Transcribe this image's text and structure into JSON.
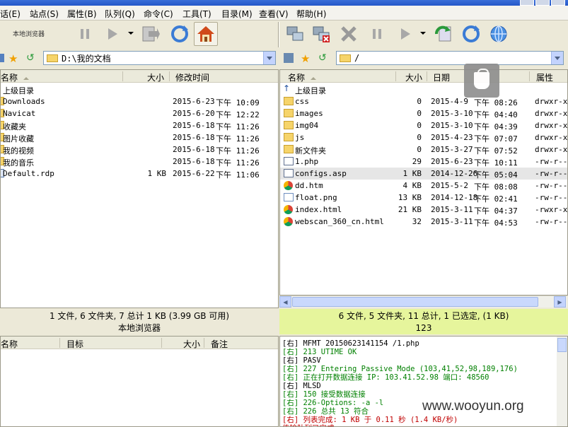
{
  "menu": [
    "话(E)",
    "站点(S)",
    "属性(B)",
    "队列(Q)",
    "命令(C)",
    "工具(T)",
    "目录(M)",
    "查看(V)",
    "帮助(H)"
  ],
  "toolbar": {
    "local_label": "本地浏览器",
    "local_icons": [
      "pause-icon",
      "play-icon",
      "dropdown-icon",
      "download-icon",
      "refresh-icon",
      "home-icon"
    ],
    "remote_icons": [
      "connect-icon",
      "disconnect-icon",
      "delete-icon",
      "pause-icon",
      "play-icon",
      "dropdown-icon",
      "upload-icon",
      "refresh-icon",
      "globe-icon"
    ]
  },
  "local": {
    "path": "D:\\我的文档",
    "headers": {
      "name": "名称",
      "size": "大小",
      "modified": "修改时间"
    },
    "rows": [
      {
        "name": "上级目录",
        "size": "",
        "date": "",
        "time": "",
        "icon": "up"
      },
      {
        "name": "Downloads",
        "size": "",
        "date": "2015-6-23",
        "time": "下午 10:09",
        "icon": "folder"
      },
      {
        "name": "Navicat",
        "size": "",
        "date": "2015-6-20",
        "time": "下午 12:22",
        "icon": "folder"
      },
      {
        "name": "收藏夹",
        "size": "",
        "date": "2015-6-18",
        "time": "下午 11:26",
        "icon": "folder"
      },
      {
        "name": "图片收藏",
        "size": "",
        "date": "2015-6-18",
        "time": "下午 11:26",
        "icon": "folder"
      },
      {
        "name": "我的视频",
        "size": "",
        "date": "2015-6-18",
        "time": "下午 11:26",
        "icon": "folder"
      },
      {
        "name": "我的音乐",
        "size": "",
        "date": "2015-6-18",
        "time": "下午 11:26",
        "icon": "folder"
      },
      {
        "name": "Default.rdp",
        "size": "1 KB",
        "date": "2015-6-22",
        "time": "下午 11:06",
        "icon": "rdp"
      }
    ],
    "status_line1": "1 文件, 6 文件夹, 7 总计 1 KB (3.99 GB 可用)",
    "status_line2": "本地浏览器"
  },
  "remote": {
    "path": "/",
    "headers": {
      "name": "名称",
      "size": "大小",
      "date": "日期",
      "attr": "属性"
    },
    "rows": [
      {
        "name": "上级目录",
        "size": "",
        "date": "",
        "time": "",
        "attr": "",
        "icon": "up"
      },
      {
        "name": "css",
        "size": "0",
        "date": "2015-4-9",
        "time": "下午 08:26",
        "attr": "drwxr-xr",
        "icon": "folder"
      },
      {
        "name": "images",
        "size": "0",
        "date": "2015-3-10",
        "time": "下午 04:40",
        "attr": "drwxr-xr",
        "icon": "folder"
      },
      {
        "name": "img04",
        "size": "0",
        "date": "2015-3-10",
        "time": "下午 04:39",
        "attr": "drwxr-xr",
        "icon": "folder"
      },
      {
        "name": "js",
        "size": "0",
        "date": "2015-4-23",
        "time": "下午 07:07",
        "attr": "drwxr-xr",
        "icon": "folder"
      },
      {
        "name": "新文件夹",
        "size": "0",
        "date": "2015-3-27",
        "time": "下午 07:52",
        "attr": "drwxr-xr",
        "icon": "folder"
      },
      {
        "name": "1.php",
        "size": "29",
        "date": "2015-6-23",
        "time": "下午 10:11",
        "attr": "-rw-r--r",
        "icon": "file"
      },
      {
        "name": "configs.asp",
        "size": "1 KB",
        "date": "2014-12-26",
        "time": "下午 05:04",
        "attr": "-rw-r--r",
        "icon": "file",
        "selected": true
      },
      {
        "name": "dd.htm",
        "size": "4 KB",
        "date": "2015-5-2",
        "time": "下午 08:08",
        "attr": "-rw-r--r",
        "icon": "chrome"
      },
      {
        "name": "float.png",
        "size": "13 KB",
        "date": "2014-12-18",
        "time": "下午 02:41",
        "attr": "-rw-r--r",
        "icon": "png"
      },
      {
        "name": "index.html",
        "size": "21 KB",
        "date": "2015-3-11",
        "time": "下午 04:37",
        "attr": "-rwxr-xr",
        "icon": "chrome"
      },
      {
        "name": "webscan_360_cn.html",
        "size": "32",
        "date": "2015-3-11",
        "time": "下午 04:53",
        "attr": "-rw-r--r",
        "icon": "chrome"
      }
    ],
    "status_line1": "6 文件, 5 文件夹, 11 总计, 1 已选定, (1 KB)",
    "status_line2": "123"
  },
  "queue": {
    "headers": {
      "name": "名称",
      "target": "目标",
      "size": "大小",
      "note": "备注"
    }
  },
  "log": [
    {
      "text": "[右] MFMT 20150623141154 /1.php",
      "color": "#000000"
    },
    {
      "text": "[右] 213 UTIME OK",
      "color": "#008000"
    },
    {
      "text": "[右] PASV",
      "color": "#000000"
    },
    {
      "text": "[右] 227 Entering Passive Mode (103,41,52,98,189,176)",
      "color": "#008000"
    },
    {
      "text": "[右] 正在打开数据连接 IP: 103.41.52.98 端口: 48560",
      "color": "#008000"
    },
    {
      "text": "[右] MLSD",
      "color": "#000000"
    },
    {
      "text": "[右] 150 接受数据连接",
      "color": "#008000"
    },
    {
      "text": "[右] 226-Options: -a -l",
      "color": "#008000"
    },
    {
      "text": "[右] 226 总共 13 符合",
      "color": "#008000"
    },
    {
      "text": "[右] 列表完成: 1 KB 于 0.11 秒 (1.4 KB/秒)",
      "color": "#c00000"
    },
    {
      "text": "传输队列已完成",
      "color": "#c00000"
    }
  ],
  "watermark": "www.wooyun.org"
}
